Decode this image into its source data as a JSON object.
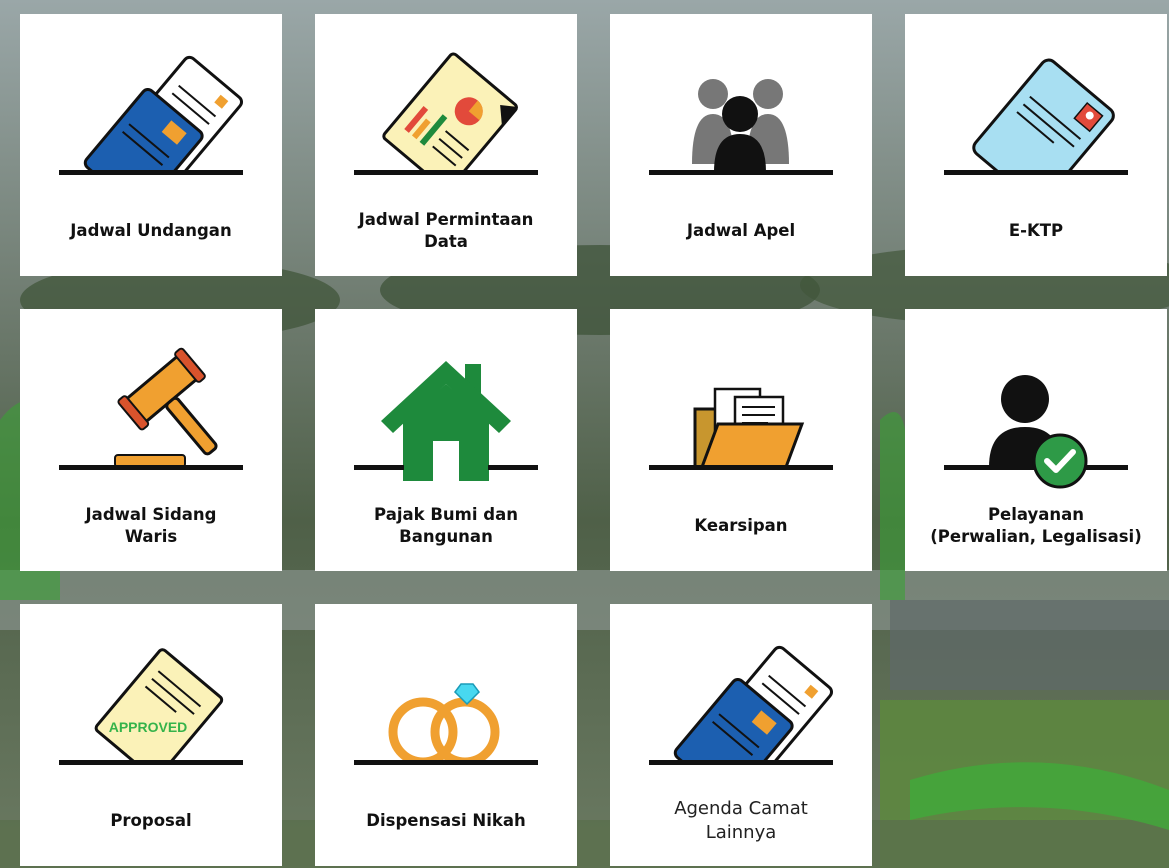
{
  "colors": {
    "line": "#111111",
    "green": "#1e8a3c",
    "orange": "#f0a030",
    "blue": "#1c5fb0",
    "light_blue": "#a8dff2",
    "paper": "#fbf2b8"
  },
  "tiles": [
    {
      "label": "Jadwal Undangan",
      "icon": "card-in-slot-icon"
    },
    {
      "label": "Jadwal Permintaan\nData",
      "icon": "report-document-icon"
    },
    {
      "label": "Jadwal Apel",
      "icon": "people-group-icon"
    },
    {
      "label": "E-KTP",
      "icon": "id-card-icon"
    },
    {
      "label": "Jadwal Sidang\nWaris",
      "icon": "gavel-icon"
    },
    {
      "label": "Pajak Bumi dan\nBangunan",
      "icon": "house-icon"
    },
    {
      "label": "Kearsipan",
      "icon": "folder-icon"
    },
    {
      "label": "Pelayanan\n(Perwalian, Legalisasi)",
      "icon": "user-check-icon"
    },
    {
      "label": "Proposal",
      "icon": "approved-document-icon",
      "stamp": "APPROVED"
    },
    {
      "label": "Dispensasi Nikah",
      "icon": "wedding-rings-icon"
    },
    {
      "label": "Agenda Camat\nLainnya",
      "icon": "card-in-slot-icon"
    }
  ]
}
